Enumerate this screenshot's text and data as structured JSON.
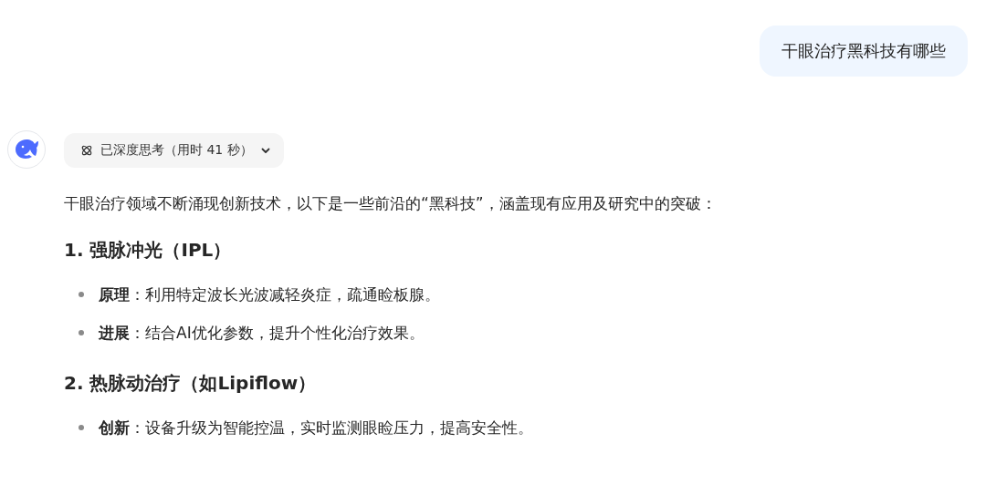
{
  "user_message": "干眼治疗黑科技有哪些",
  "assistant": {
    "thinking_label": "已深度思考（用时 41 秒）",
    "blocks": [
      {
        "kind": "paragraph",
        "text": "干眼治疗领域不断涌现创新技术，以下是一些前沿的“黑科技”，涵盖现有应用及研究中的突破："
      },
      {
        "kind": "heading",
        "text": "1. 强脉冲光（IPL）"
      },
      {
        "kind": "bullet",
        "text": "**原理**：利用特定波长光波减轻炎症，疏通睑板腺。"
      },
      {
        "kind": "bullet",
        "text": "**进展**：结合AI优化参数，提升个性化治疗效果。"
      },
      {
        "kind": "heading",
        "text": "2. 热脉动治疗（如Lipiflow）"
      },
      {
        "kind": "bullet",
        "text": "**创新**：设备升级为智能控温，实时监测眼睑压力，提高安全性。"
      }
    ]
  }
}
